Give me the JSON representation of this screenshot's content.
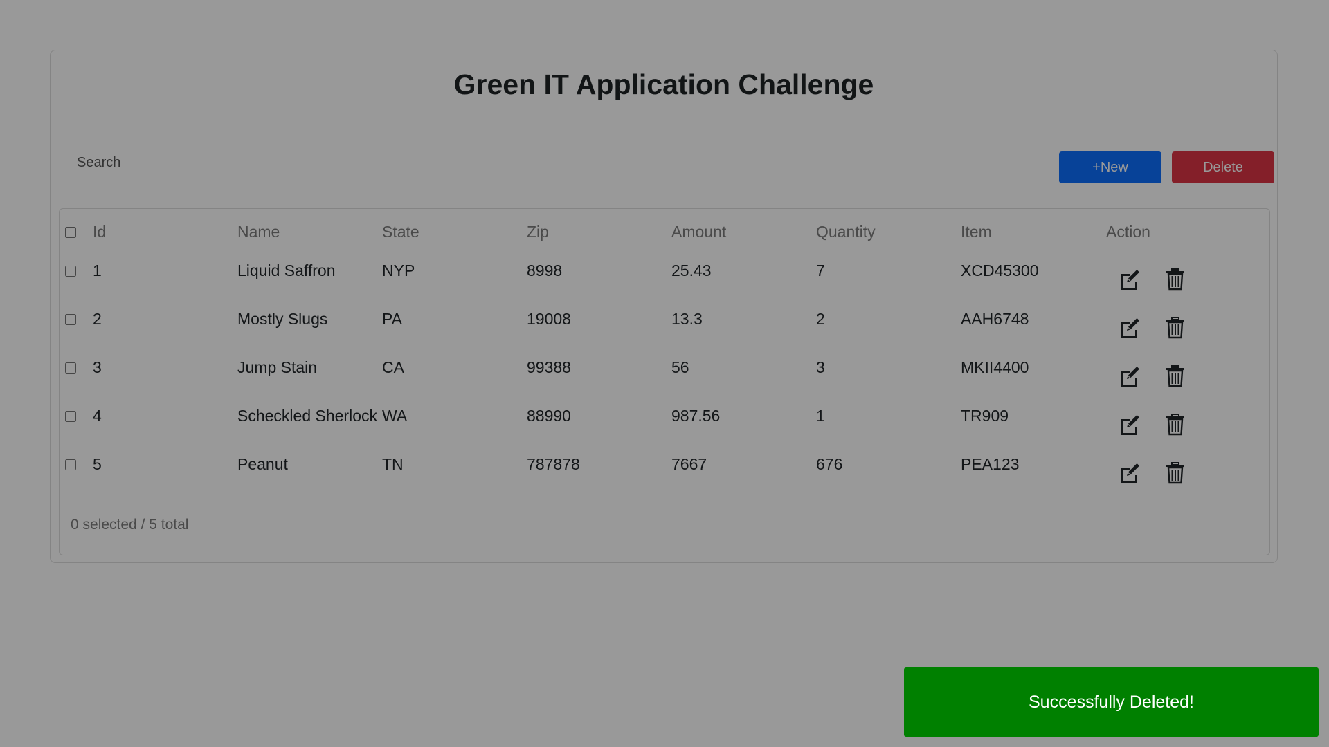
{
  "app": {
    "title": "Green IT Application Challenge"
  },
  "search": {
    "placeholder": "Search",
    "value": ""
  },
  "toolbar": {
    "new_label": "+New",
    "delete_label": "Delete"
  },
  "table": {
    "headers": {
      "id": "Id",
      "name": "Name",
      "state": "State",
      "zip": "Zip",
      "amount": "Amount",
      "quantity": "Quantity",
      "item": "Item",
      "action": "Action"
    },
    "rows": [
      {
        "id": "1",
        "name": "Liquid Saffron",
        "state": "NYP",
        "zip": "8998",
        "amount": "25.43",
        "quantity": "7",
        "item": "XCD45300"
      },
      {
        "id": "2",
        "name": "Mostly Slugs",
        "state": "PA",
        "zip": "19008",
        "amount": "13.3",
        "quantity": "2",
        "item": "AAH6748"
      },
      {
        "id": "3",
        "name": "Jump Stain",
        "state": "CA",
        "zip": "99388",
        "amount": "56",
        "quantity": "3",
        "item": "MKII4400"
      },
      {
        "id": "4",
        "name": "Scheckled Sherlock",
        "state": "WA",
        "zip": "88990",
        "amount": "987.56",
        "quantity": "1",
        "item": "TR909"
      },
      {
        "id": "5",
        "name": "Peanut",
        "state": "TN",
        "zip": "787878",
        "amount": "7667",
        "quantity": "676",
        "item": "PEA123"
      }
    ],
    "footer": "0 selected / 5 total"
  },
  "toast": {
    "message": "Successfully Deleted!"
  },
  "colors": {
    "new_button": "#0d6efd",
    "delete_button": "#dc3545",
    "toast": "#008000",
    "overlay": "rgba(0,0,0,0.4)"
  },
  "icons": {
    "edit": "edit-icon",
    "delete": "trash-icon"
  }
}
